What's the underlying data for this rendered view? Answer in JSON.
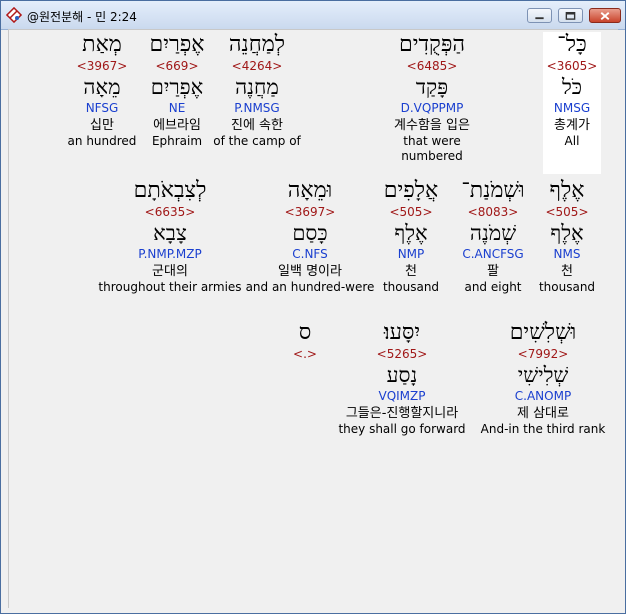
{
  "window": {
    "title": "@원전분해 - 민 2:24"
  },
  "words": [
    {
      "hebrew": "כָּל־",
      "strong": "<3605>",
      "lemma": "כֹּל",
      "morph": "NMSG",
      "korean": "총계가",
      "english": "All",
      "highlight": true
    },
    {
      "hebrew": "הַפְּקֻדִים",
      "strong": "<6485>",
      "lemma": "פָּקַד",
      "morph": "D.VQPPMP",
      "korean": "계수함을 입은",
      "english": "that were numbered",
      "highlight": false
    },
    {
      "hebrew": "לְמַחֲנֵה",
      "strong": "<4264>",
      "lemma": "מַחֲנֶה",
      "morph": "P.NMSG",
      "korean": "진에 속한",
      "english": "of the camp of",
      "highlight": false
    },
    {
      "hebrew": "אֶפְרַיִם",
      "strong": "<669>",
      "lemma": "אֶפְרַיִם",
      "morph": "NE",
      "korean": "에브라임",
      "english": "Ephraim",
      "highlight": false
    },
    {
      "hebrew": "מְאַת",
      "strong": "<3967>",
      "lemma": "מֵאָה",
      "morph": "NFSG",
      "korean": "십만",
      "english": "an hundred",
      "highlight": false
    },
    {
      "hebrew": "אֶלֶף",
      "strong": "<505>",
      "lemma": "אֶלֶף",
      "morph": "NMS",
      "korean": "천",
      "english": "thousand",
      "highlight": false
    },
    {
      "hebrew": "וּשְׁמֹנַת־",
      "strong": "<8083>",
      "lemma": "שְׁמֹנֶה",
      "morph": "C.ANCFSG",
      "korean": "팔",
      "english": "and eight",
      "highlight": false
    },
    {
      "hebrew": "אֲלָפִים",
      "strong": "<505>",
      "lemma": "אֶלֶף",
      "morph": "NMP",
      "korean": "천",
      "english": "thousand",
      "highlight": false
    },
    {
      "hebrew": "וּמֵאָה",
      "strong": "<3697>",
      "lemma": "כָּסַם",
      "morph": "C.NFS",
      "korean": "일백 명이라",
      "english": "and an hundred-were",
      "highlight": false
    },
    {
      "hebrew": "לְצִבְאֹתָם",
      "strong": "<6635>",
      "lemma": "צָבָא",
      "morph": "P.NMP.MZP",
      "korean": "군대의",
      "english": "throughout their armies",
      "highlight": false
    },
    {
      "hebrew": "וּשְׁלִשִׁים",
      "strong": "<7992>",
      "lemma": "שְׁלִישִׁי",
      "morph": "C.ANOMP",
      "korean": "제 삼대로",
      "english": "And-in the third rank",
      "highlight": false
    },
    {
      "hebrew": "יִסָּעוּ׃",
      "strong": "<5265>",
      "lemma": "נָסַע",
      "morph": "VQIMZP",
      "korean": "그들은-진행할지니라",
      "english": "they shall go forward",
      "highlight": false
    },
    {
      "hebrew": "ס",
      "strong": "<.>",
      "lemma": "",
      "morph": "",
      "korean": "",
      "english": "",
      "highlight": false
    }
  ]
}
